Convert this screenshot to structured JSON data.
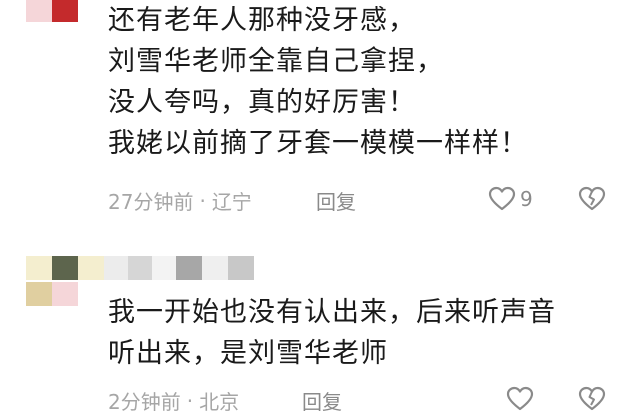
{
  "colors": {
    "text": "#1a1a1a",
    "meta": "#a6a6a6",
    "icon": "#8a8a8a",
    "avatar_red": "#c42a2c",
    "avatar_pink": "#f5d6d9",
    "avatar_olive": "#5d654d",
    "avatar_gray": "#a7a7a7",
    "avatar_cream": "#f4eecf",
    "avatar_tan": "#e0cfa0",
    "avatar_light": "#ececec"
  },
  "comments": [
    {
      "lines": [
        "还有老年人那种没牙感，",
        "刘雪华老师全靠自己拿捏，",
        "没人夸吗，真的好厉害！",
        "我姥以前摘了牙套一模模一样样！"
      ],
      "time": "27分钟前",
      "separator": "·",
      "location": "辽宁",
      "reply_label": "回复",
      "like_count": "9",
      "like_icon": "heart-outline-icon",
      "dislike_icon": "broken-heart-icon"
    },
    {
      "lines": [
        "我一开始也没有认出来，后来听声音",
        "听出来，是刘雪华老师"
      ],
      "time": "2分钟前",
      "separator": "·",
      "location": "北京",
      "reply_label": "回复",
      "like_count": "",
      "like_icon": "heart-outline-icon",
      "dislike_icon": "broken-heart-icon"
    }
  ]
}
